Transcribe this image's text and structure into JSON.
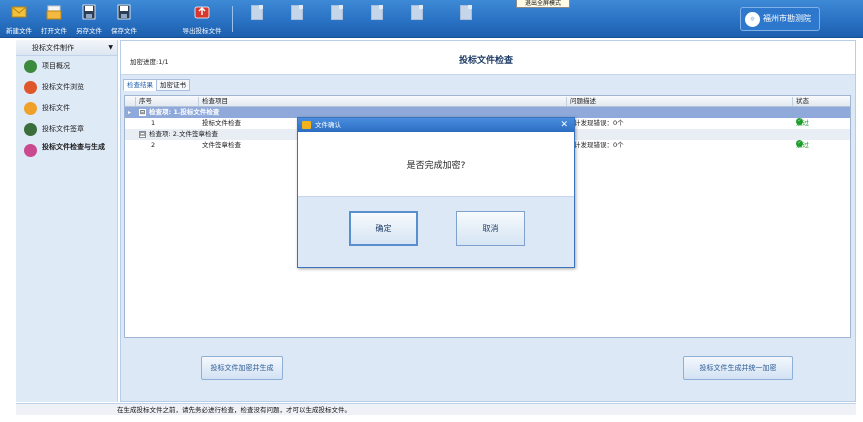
{
  "toolbar": {
    "buttons": [
      {
        "label": "新建文件",
        "icon": "envelope-icon"
      },
      {
        "label": "打开文件",
        "icon": "folder-icon"
      },
      {
        "label": "另存文件",
        "icon": "save-as-icon"
      },
      {
        "label": "保存文件",
        "icon": "save-icon"
      },
      {
        "label": "导出投标文件",
        "icon": "export-icon"
      }
    ],
    "disabled_buttons": [
      "",
      "",
      "",
      "",
      "",
      ""
    ],
    "tooltip": "退出全屏模式",
    "brand": "福州市勘测院",
    "colors": {
      "bar": "#2a72c4",
      "brand_bg": "#2d78cc"
    }
  },
  "sidebar": {
    "header": "投标文件制作",
    "items": [
      {
        "label": "项目概况",
        "color": "#3b8a3e"
      },
      {
        "label": "投标文件浏览",
        "color": "#e0562b"
      },
      {
        "label": "投标文件",
        "color": "#f0a12a"
      },
      {
        "label": "投标文件签章",
        "color": "#3a6f3c"
      },
      {
        "label": "投标文件检查与生成",
        "color": "#c94a8f"
      }
    ]
  },
  "content": {
    "progress_label": "加密进度:1/1",
    "title": "投标文件检查",
    "tabs": [
      "检查结果",
      "加密证书"
    ],
    "grid": {
      "columns": [
        "序号",
        "检查项目",
        "问题描述",
        "状态"
      ],
      "groups": [
        {
          "label": "检查项: 1.投标文件检查",
          "expander": "⊟"
        },
        {
          "label": "检查项: 2.文件签章检查",
          "expander": "⊟"
        }
      ],
      "rows": [
        {
          "no": "1",
          "item": "投标文件检查",
          "desc": "计发现错误：0个",
          "status": "通过"
        },
        {
          "no": "2",
          "item": "文件签章检查",
          "desc": "计发现错误：0个",
          "status": "通过"
        }
      ]
    },
    "btn_encrypt": "投标文件加密并生成",
    "btn_unified": "投标文件生成并统一加密"
  },
  "status_text": "在生成投标文件之前，请先务必进行检查，检查没有问题，才可以生成投标文件。",
  "dialog": {
    "title": "文件确认",
    "message": "是否完成加密?",
    "confirm": "确定",
    "cancel": "取消"
  }
}
